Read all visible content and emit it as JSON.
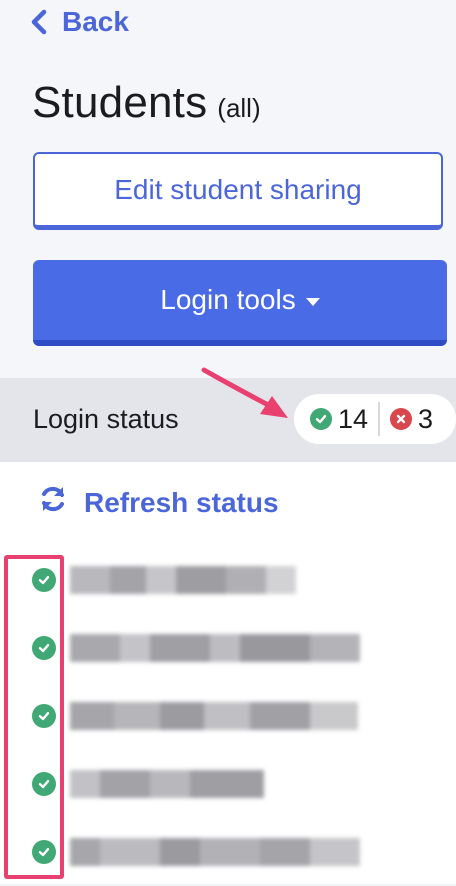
{
  "back": {
    "label": "Back",
    "icon": "chevron-left-icon"
  },
  "title": {
    "main": "Students",
    "sub": "(all)"
  },
  "buttons": {
    "edit_sharing": "Edit student sharing",
    "login_tools": "Login tools"
  },
  "login_status": {
    "label": "Login status",
    "logged_in_count": "14",
    "not_logged_in_count": "3"
  },
  "refresh": {
    "label": "Refresh status",
    "icon": "refresh-icon"
  },
  "students": [
    {
      "status": "logged-in",
      "name_redacted": true
    },
    {
      "status": "logged-in",
      "name_redacted": true
    },
    {
      "status": "logged-in",
      "name_redacted": true
    },
    {
      "status": "logged-in",
      "name_redacted": true
    },
    {
      "status": "logged-in",
      "name_redacted": true
    }
  ],
  "colors": {
    "accent": "#4a66d9",
    "primary_button": "#4a6be6",
    "success": "#3fa874",
    "error": "#d8464e",
    "annotation": "#e8406f"
  }
}
